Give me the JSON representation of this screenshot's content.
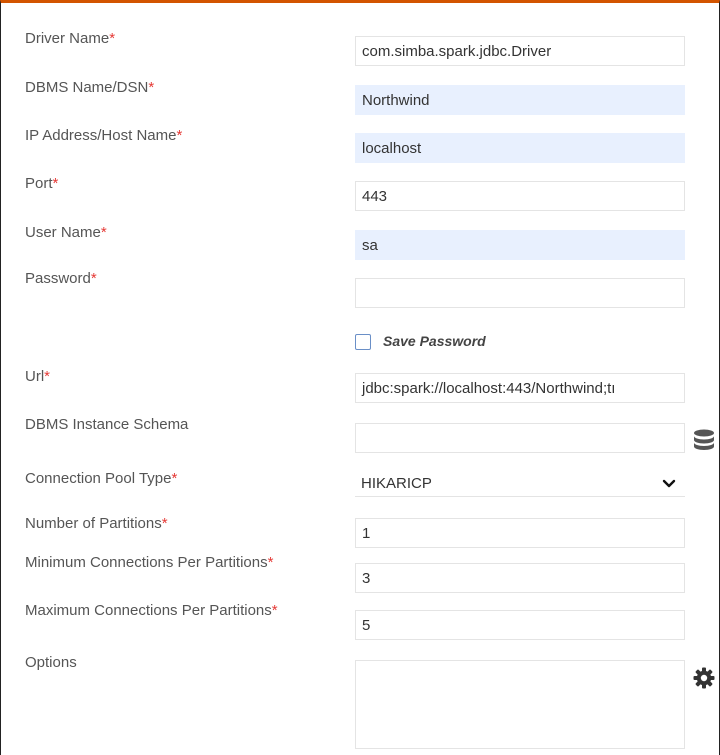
{
  "form": {
    "driver_name": {
      "label": "Driver Name",
      "required": "*",
      "value": "com.simba.spark.jdbc.Driver"
    },
    "dbms_name": {
      "label": "DBMS Name/DSN",
      "required": "*",
      "value": "Northwind"
    },
    "ip_address": {
      "label": "IP Address/Host Name",
      "required": "*",
      "value": "localhost"
    },
    "port": {
      "label": "Port",
      "required": "*",
      "value": "443"
    },
    "user_name": {
      "label": "User Name",
      "required": "*",
      "value": "sa"
    },
    "password": {
      "label": "Password",
      "required": "*",
      "value": ""
    },
    "save_password": {
      "label": "Save Password",
      "checked": false
    },
    "url": {
      "label": "Url",
      "required": "*",
      "value": "jdbc:spark://localhost:443/Northwind;tı"
    },
    "dbms_instance_schema": {
      "label": "DBMS Instance Schema",
      "value": ""
    },
    "connection_pool_type": {
      "label": "Connection Pool Type",
      "required": "*",
      "value": "HIKARICP"
    },
    "number_of_partitions": {
      "label": "Number of Partitions",
      "required": "*",
      "value": "1"
    },
    "min_connections": {
      "label": "Minimum Connections Per Partitions",
      "required": "*",
      "value": "3"
    },
    "max_connections": {
      "label": "Maximum Connections Per Partitions",
      "required": "*",
      "value": "5"
    },
    "options": {
      "label": "Options",
      "value": ""
    }
  },
  "colors": {
    "accent": "#d35400",
    "required": "#e53935",
    "filled_bg": "#e8f0fe"
  },
  "icons": {
    "schema": "database-icon",
    "options": "gear-icon",
    "pool_type": "chevron-down-icon"
  }
}
